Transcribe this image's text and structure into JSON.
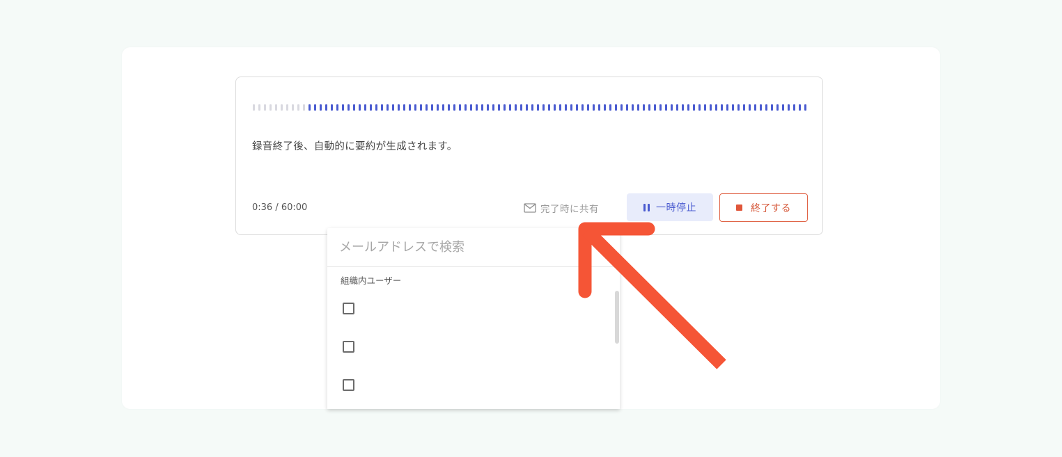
{
  "recorder": {
    "waveform": {
      "played_fraction": 0.1,
      "colors": {
        "inactive": "#d9d9e0",
        "active": "#4a5bd0"
      }
    },
    "notice": "録音終了後、自動的に要約が生成されます。",
    "timer": "0:36 / 60:00",
    "share_label": "完了時に共有",
    "share_icon": "mail-icon",
    "pause_label": "一時停止",
    "pause_icon": "pause-icon",
    "stop_label": "終了する",
    "stop_icon": "stop-icon"
  },
  "share_dropdown": {
    "search_placeholder": "メールアドレスで検索",
    "search_value": "",
    "group_label": "組織内ユーザー",
    "users": [
      {
        "checked": false
      },
      {
        "checked": false
      },
      {
        "checked": false
      }
    ]
  },
  "annotation": {
    "arrow_color": "#f55536"
  },
  "colors": {
    "accent": "#4a5bd0",
    "danger": "#e0563a",
    "background": "#f5faf8"
  }
}
